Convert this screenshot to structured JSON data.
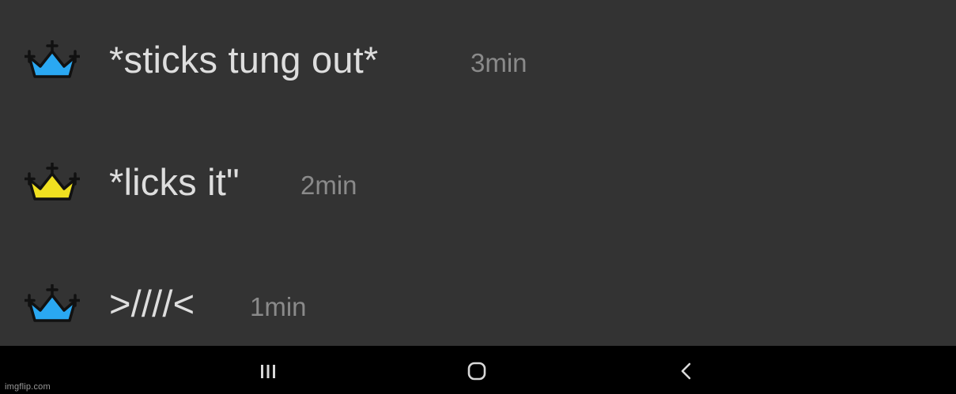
{
  "messages": [
    {
      "text": "*sticks tung out*",
      "time": "3min",
      "crown_color": "#2aa8f2",
      "icon": "crown-icon"
    },
    {
      "text": "*licks it\"",
      "time": "2min",
      "crown_color": "#f0e020",
      "icon": "crown-icon"
    },
    {
      "text": ">////<",
      "time": "1min",
      "crown_color": "#2aa8f2",
      "icon": "crown-icon"
    }
  ],
  "navbar": {
    "recents_icon": "recents-icon",
    "home_icon": "home-icon",
    "back_icon": "back-icon"
  },
  "watermark": "imgflip.com",
  "colors": {
    "background": "#333333",
    "text": "#dedede",
    "timestamp": "#8a8a8a",
    "navbar": "#000000"
  }
}
